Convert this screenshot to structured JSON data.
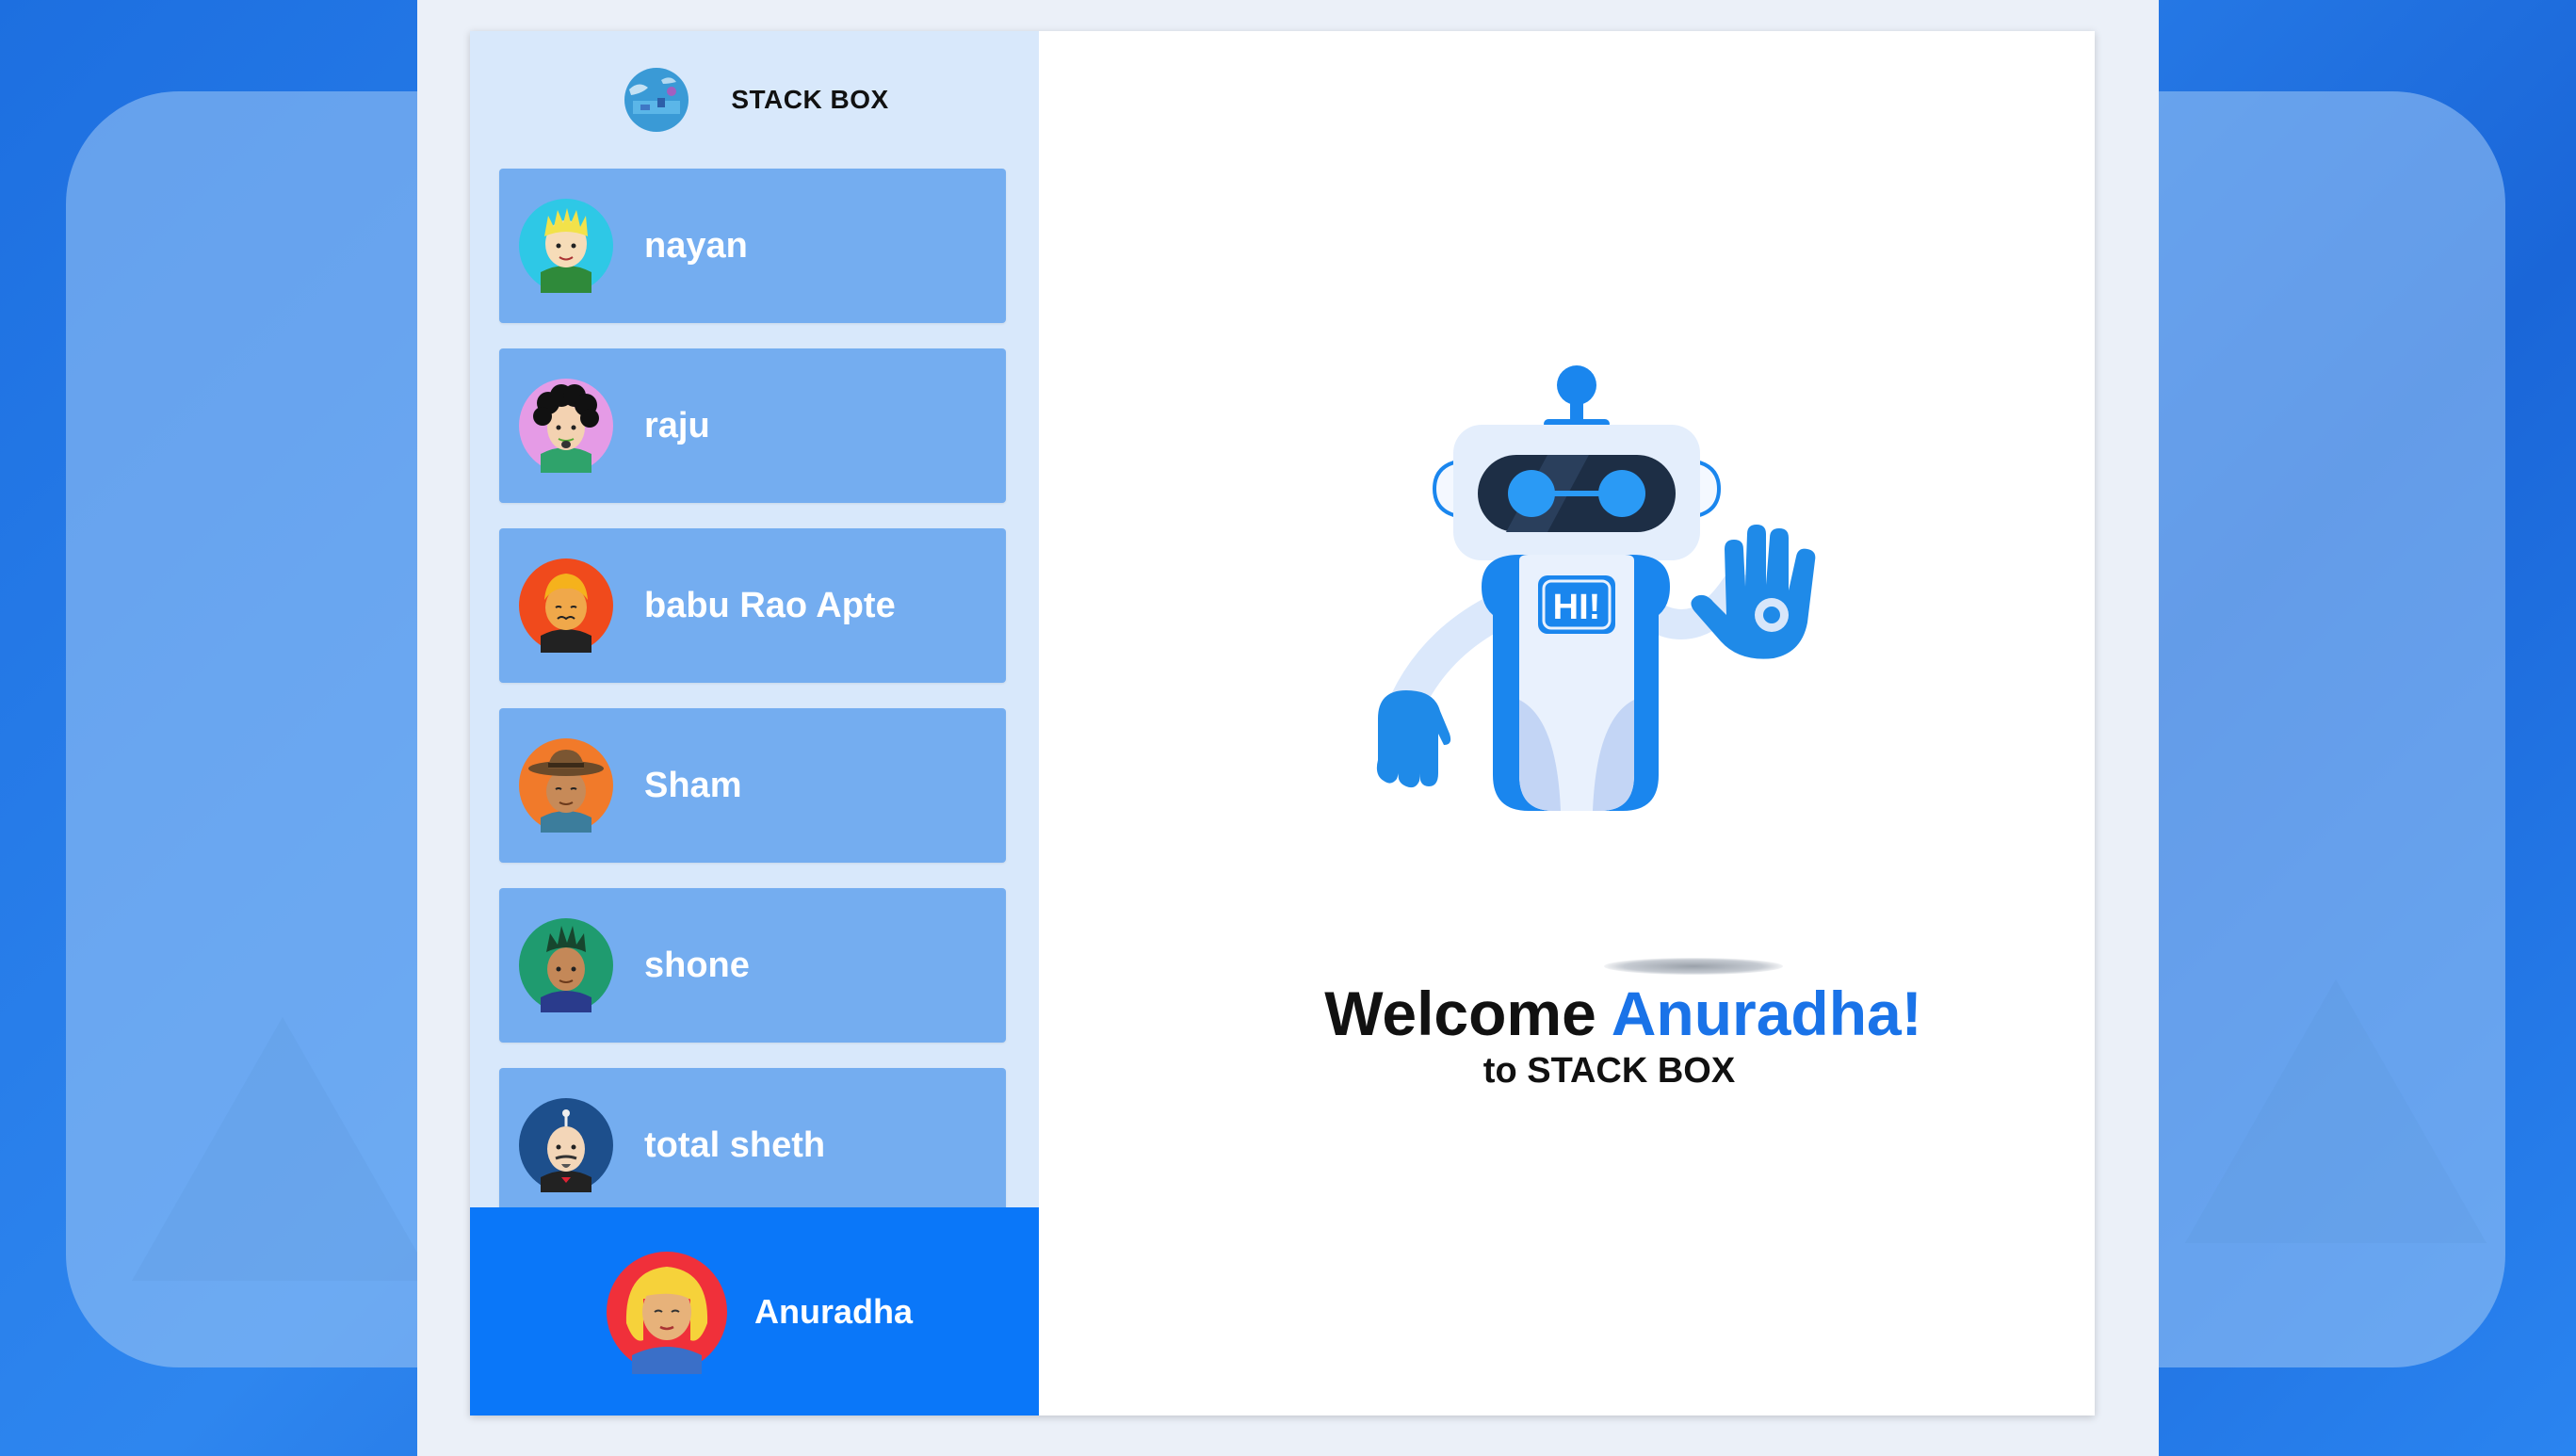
{
  "brand": {
    "name": "STACK BOX",
    "logo_icon": "globe-logo-icon"
  },
  "contacts": [
    {
      "name": "nayan",
      "avatar_icon": "avatar-blond-boy-icon",
      "avatar_bg": "#2ec8e6"
    },
    {
      "name": "raju",
      "avatar_icon": "avatar-curly-hair-icon",
      "avatar_bg": "#e59be6"
    },
    {
      "name": "babu Rao Apte",
      "avatar_icon": "avatar-orange-hair-icon",
      "avatar_bg": "#f04a1c"
    },
    {
      "name": "Sham",
      "avatar_icon": "avatar-hat-man-icon",
      "avatar_bg": "#f17a2a"
    },
    {
      "name": "shone",
      "avatar_icon": "avatar-spiky-hair-icon",
      "avatar_bg": "#1f9b6f"
    },
    {
      "name": "total sheth",
      "avatar_icon": "avatar-bald-old-man-icon",
      "avatar_bg": "#1d4f8c"
    }
  ],
  "current_user": {
    "name": "Anuradha",
    "avatar_icon": "avatar-blonde-woman-icon",
    "avatar_bg": "#f0303a"
  },
  "welcome": {
    "greeting": "Welcome",
    "user_name": "Anuradha!",
    "subtitle": "to STACK BOX",
    "robot_badge": "HI!"
  },
  "colors": {
    "accent": "#0a77f9",
    "sidebar_bg": "#d8e8fb",
    "contact_bg": "#74adf0",
    "name_highlight": "#1a73e8"
  }
}
